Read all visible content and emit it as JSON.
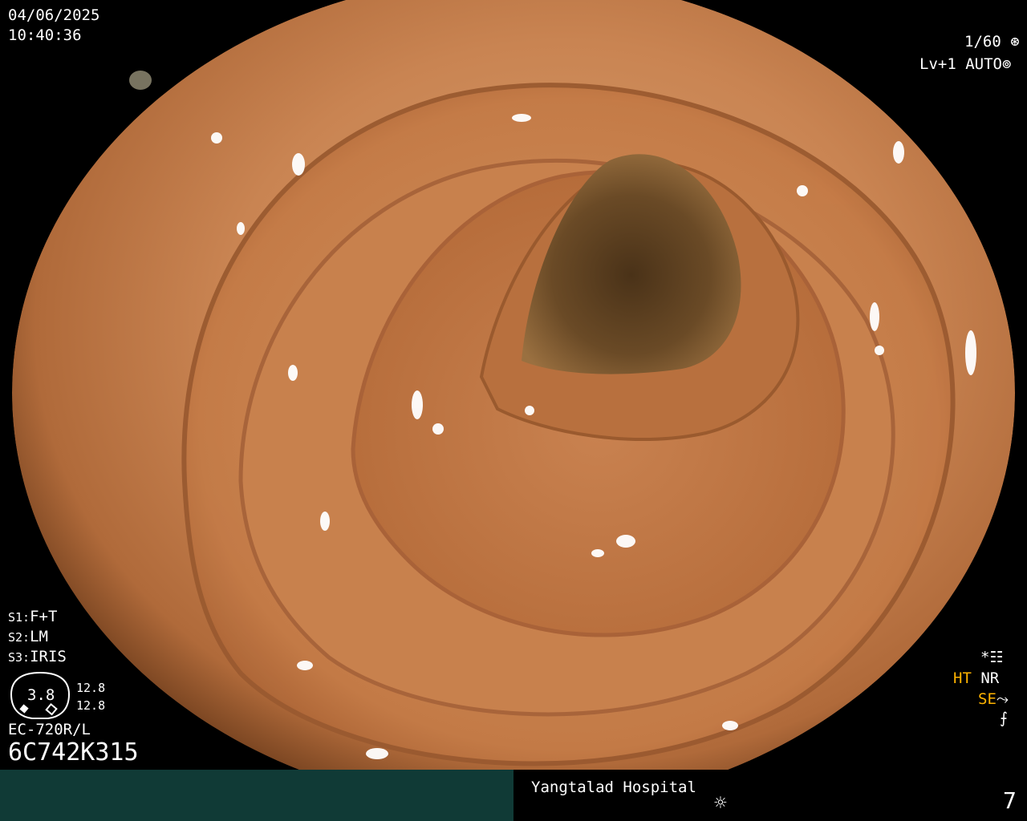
{
  "header": {
    "date": "04/06/2025",
    "time": "10:40:36"
  },
  "top_right": {
    "shutter": "1/60",
    "shutter_icon": "aperture-icon",
    "level": "Lv+1",
    "mode": "AUTO",
    "mode_icon": "iris-icon"
  },
  "scope_settings": {
    "s1_label": "S1:",
    "s1_value": "F+T",
    "s2_label": "S2:",
    "s2_value": "LM",
    "s3_label": "S3:",
    "s3_value": "IRIS",
    "gauge_value": "3.8",
    "readout_top": "12.8",
    "readout_bottom": "12.8",
    "model": "EC-720R/L",
    "serial": "6C742K315"
  },
  "right_indicators": {
    "asterisk": "*",
    "ht": "HT",
    "nr": "NR",
    "se": "SE",
    "settings_icon": "settings-panel-icon",
    "curve_icon": "enhance-curve-icon",
    "flash_icon": "no-flash-icon"
  },
  "footer": {
    "hospital": "Yangtalad Hospital",
    "light_icon": "sun-icon",
    "image_count": "7"
  },
  "colors": {
    "footer_bar": "#103a36",
    "accent_orange": "#ffb300",
    "mucosa": "#c27a45"
  }
}
